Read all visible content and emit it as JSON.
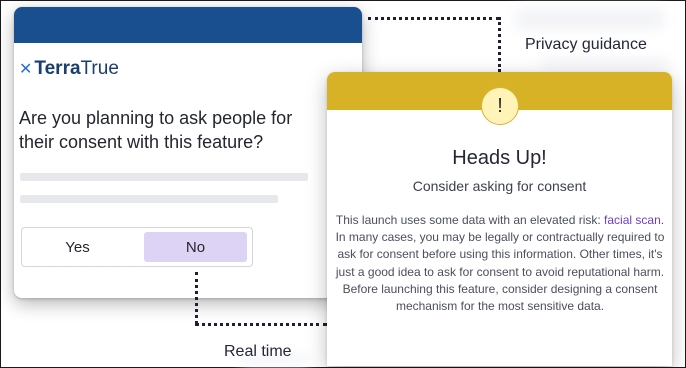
{
  "left_card": {
    "brand_mark": "✕",
    "brand_bold": "Terra",
    "brand_rest": "True",
    "question": "Are you planning to ask people for their consent with this feature?",
    "options": {
      "yes": "Yes",
      "no": "No"
    },
    "selected": "No"
  },
  "labels": {
    "privacy": "Privacy guidance",
    "realtime": "Real time"
  },
  "right_card": {
    "icon_glyph": "!",
    "title": "Heads Up!",
    "subtitle": "Consider asking for consent",
    "body_before": "This launch uses some data with an elevated risk: ",
    "body_highlight": "facial scan",
    "body_after": ". In many cases, you may be legally or contractually required to ask for consent before using this information. Other times, it's just a good idea to ask for consent to avoid reputational harm. Before launching this feature, consider designing a consent mechanism for the most sensitive data."
  },
  "colors": {
    "left_header": "#1a4f8f",
    "right_header": "#d8b226",
    "selected_option": "#ddd3f5",
    "highlight_text": "#6b3fc2"
  }
}
